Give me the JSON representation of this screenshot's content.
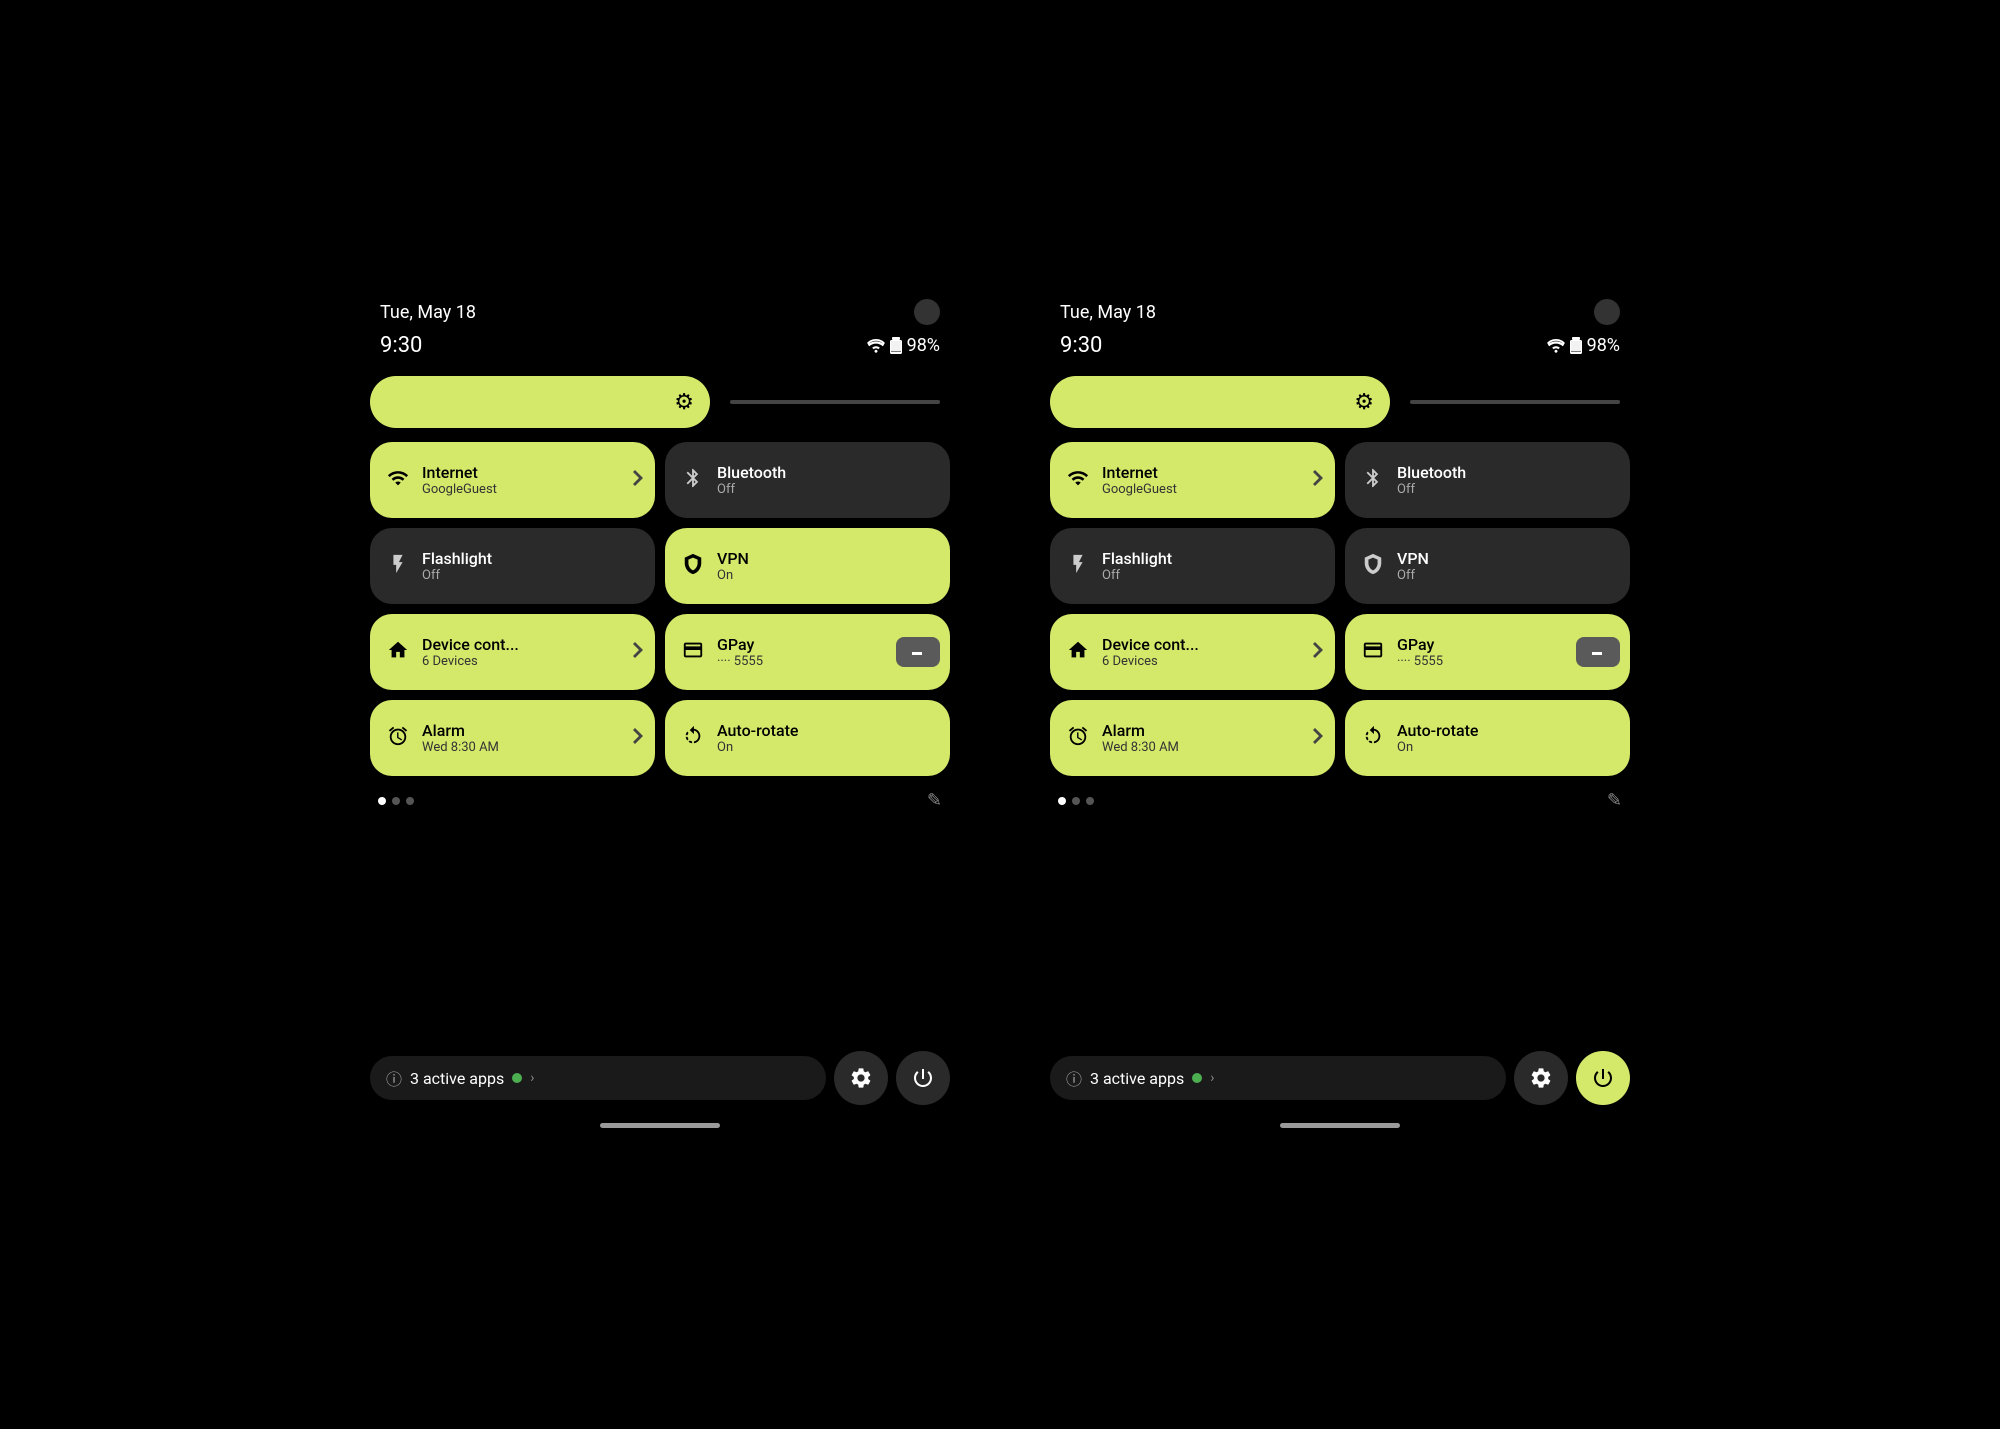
{
  "screens": [
    {
      "id": "screen-left",
      "statusBar": {
        "date": "Tue, May 18",
        "time": "9:30",
        "battery": "98%"
      },
      "tiles": [
        {
          "id": "internet",
          "title": "Internet",
          "subtitle": "GoogleGuest",
          "state": "active",
          "hasArrow": true,
          "icon": "wifi"
        },
        {
          "id": "bluetooth",
          "title": "Bluetooth",
          "subtitle": "Off",
          "state": "inactive",
          "hasArrow": false,
          "icon": "bluetooth"
        },
        {
          "id": "flashlight",
          "title": "Flashlight",
          "subtitle": "Off",
          "state": "inactive",
          "hasArrow": false,
          "icon": "flashlight"
        },
        {
          "id": "vpn",
          "title": "VPN",
          "subtitle": "On",
          "state": "active",
          "hasArrow": false,
          "icon": "vpn"
        },
        {
          "id": "device-control",
          "title": "Device cont...",
          "subtitle": "6 Devices",
          "state": "active",
          "hasArrow": true,
          "icon": "home"
        },
        {
          "id": "gpay",
          "title": "GPay",
          "subtitle": "···· 5555",
          "state": "active",
          "hasArrow": false,
          "icon": "gpay",
          "hasCard": true
        },
        {
          "id": "alarm",
          "title": "Alarm",
          "subtitle": "Wed 8:30 AM",
          "state": "active",
          "hasArrow": true,
          "icon": "alarm"
        },
        {
          "id": "autorotate",
          "title": "Auto-rotate",
          "subtitle": "On",
          "state": "active",
          "hasArrow": false,
          "icon": "autorotate"
        }
      ],
      "bottomBar": {
        "activeApps": "3 active apps",
        "powerBtnActive": false
      },
      "pagination": {
        "activeDot": 0
      }
    },
    {
      "id": "screen-right",
      "statusBar": {
        "date": "Tue, May 18",
        "time": "9:30",
        "battery": "98%"
      },
      "tiles": [
        {
          "id": "internet",
          "title": "Internet",
          "subtitle": "GoogleGuest",
          "state": "active",
          "hasArrow": true,
          "icon": "wifi"
        },
        {
          "id": "bluetooth",
          "title": "Bluetooth",
          "subtitle": "Off",
          "state": "inactive",
          "hasArrow": false,
          "icon": "bluetooth"
        },
        {
          "id": "flashlight",
          "title": "Flashlight",
          "subtitle": "Off",
          "state": "inactive",
          "hasArrow": false,
          "icon": "flashlight"
        },
        {
          "id": "vpn",
          "title": "VPN",
          "subtitle": "Off",
          "state": "inactive",
          "hasArrow": false,
          "icon": "vpn"
        },
        {
          "id": "device-control",
          "title": "Device cont...",
          "subtitle": "6 Devices",
          "state": "active",
          "hasArrow": true,
          "icon": "home"
        },
        {
          "id": "gpay",
          "title": "GPay",
          "subtitle": "···· 5555",
          "state": "active",
          "hasArrow": false,
          "icon": "gpay",
          "hasCard": true
        },
        {
          "id": "alarm",
          "title": "Alarm",
          "subtitle": "Wed 8:30 AM",
          "state": "active",
          "hasArrow": true,
          "icon": "alarm"
        },
        {
          "id": "autorotate",
          "title": "Auto-rotate",
          "subtitle": "On",
          "state": "active",
          "hasArrow": false,
          "icon": "autorotate"
        }
      ],
      "bottomBar": {
        "activeApps": "3 active apps",
        "powerBtnActive": true
      },
      "pagination": {
        "activeDot": 0
      }
    }
  ],
  "icons": {
    "wifi": "📶",
    "bluetooth": "✦",
    "flashlight": "🔦",
    "vpn": "🛡",
    "home": "⌂",
    "gpay": "💳",
    "alarm": "⏰",
    "autorotate": "↻",
    "settings": "⚙",
    "power": "⏻",
    "info": "ⓘ",
    "edit": "✎",
    "gear": "⚙",
    "battery": "🔋"
  }
}
